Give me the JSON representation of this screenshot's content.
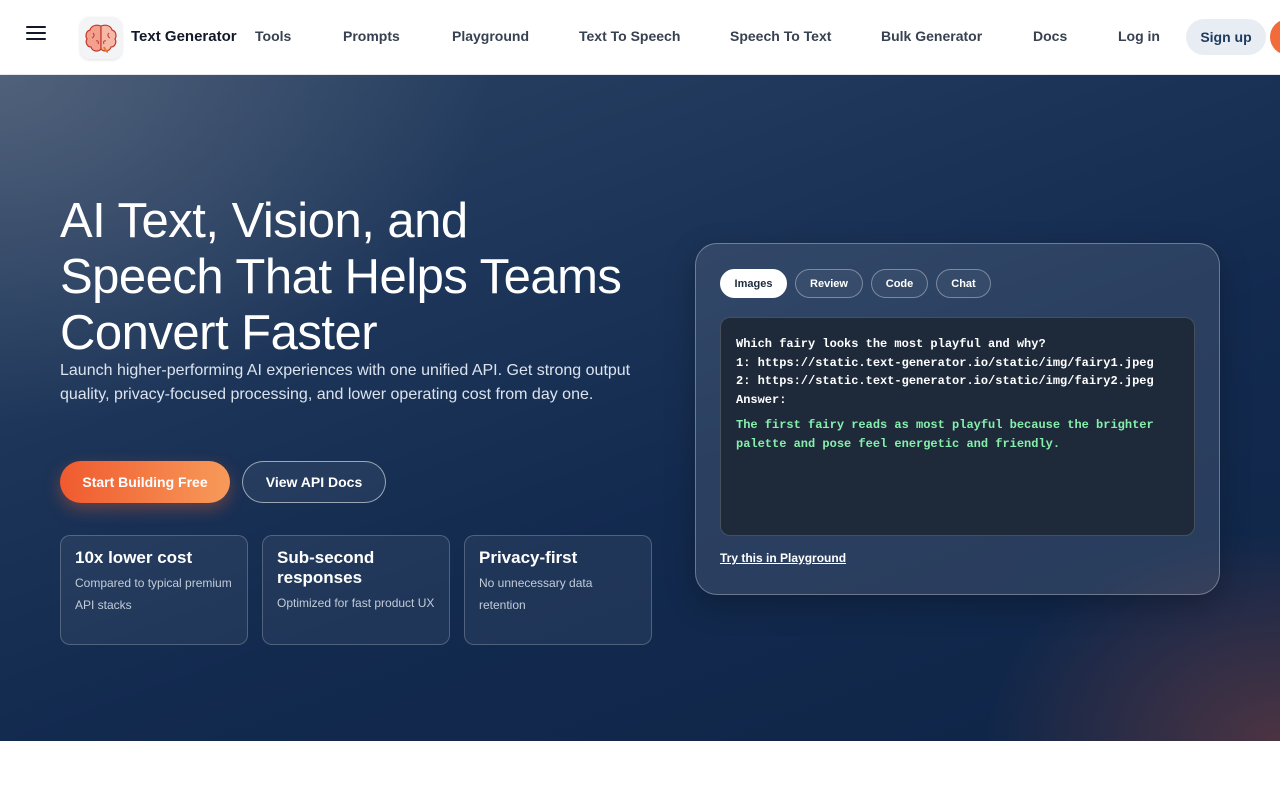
{
  "header": {
    "brand": "Text Generator",
    "nav": [
      "Tools",
      "Prompts",
      "Playground",
      "Text To Speech",
      "Speech To Text",
      "Bulk Generator",
      "Docs"
    ],
    "login": "Log in",
    "signup": "Sign up"
  },
  "hero": {
    "title_lines": [
      "AI Text, Vision, and",
      "Speech That Helps Teams",
      "Convert Faster"
    ],
    "subtitle": "Launch higher-performing AI experiences with one unified API. Get strong output quality, privacy-focused processing, and lower operating cost from day one.",
    "primary_cta": "Start Building Free",
    "secondary_cta": "View API Docs",
    "stats": [
      {
        "title": "10x lower cost",
        "desc": "Compared to typical premium API stacks"
      },
      {
        "title": "Sub-second responses",
        "desc": "Optimized for fast product UX"
      },
      {
        "title": "Privacy-first",
        "desc": "No unnecessary data retention"
      }
    ]
  },
  "demo": {
    "tabs": [
      "Images",
      "Review",
      "Code",
      "Chat"
    ],
    "active_tab": "Images",
    "prompt_lines": [
      "Which fairy looks the most playful and why?",
      "1: https://static.text-generator.io/static/img/fairy1.jpeg",
      "2: https://static.text-generator.io/static/img/fairy2.jpeg",
      "Answer:"
    ],
    "answer_lines": [
      "The first fairy reads as most playful because the brighter",
      "palette and pose feel energetic and friendly."
    ],
    "try_link": "Try this in Playground"
  },
  "icons": {
    "menu": "hamburger-menu-icon",
    "logo": "brain-logo-icon"
  },
  "colors": {
    "accent": "#f26b3a",
    "hero_bg": "#132a4f",
    "answer_text": "#86efac"
  }
}
